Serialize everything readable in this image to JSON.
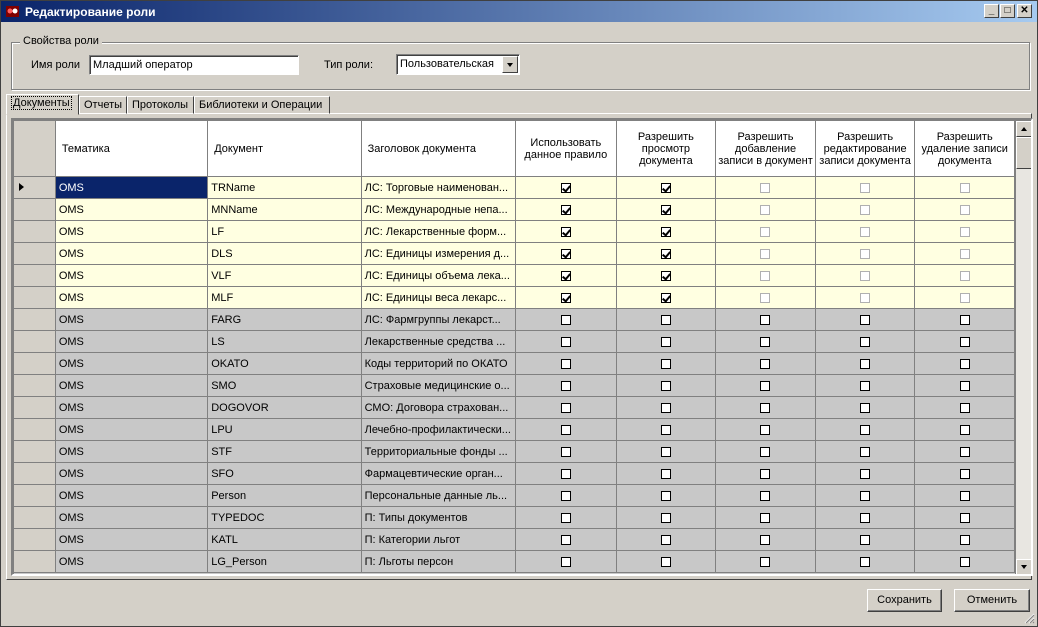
{
  "window": {
    "title": "Редактирование роли",
    "minimize": "_",
    "maximize": "□",
    "close": "✕"
  },
  "role_props": {
    "legend": "Свойства роли",
    "name_label": "Имя роли",
    "name_value": "Младший оператор",
    "type_label": "Тип роли:",
    "type_value": "Пользовательская"
  },
  "tabs": [
    {
      "label": "Документы"
    },
    {
      "label": "Отчеты"
    },
    {
      "label": "Протоколы"
    },
    {
      "label": "Библиотеки и Операции"
    }
  ],
  "grid": {
    "columns": [
      "Тематика",
      "Документ",
      "Заголовок документа",
      "Использовать данное правило",
      "Разрешить просмотр документа",
      "Разрешить добавление записи в документ",
      "Разрешить редактирование записи документа",
      "Разрешить удаление записи документа"
    ],
    "rows": [
      {
        "theme": "OMS",
        "doc": "TRName",
        "caption": "ЛС: Торговые наименован...",
        "use": true,
        "view": true,
        "add": false,
        "edit": false,
        "del": false,
        "enabled": true
      },
      {
        "theme": "OMS",
        "doc": "MNName",
        "caption": "ЛС: Международные непа...",
        "use": true,
        "view": true,
        "add": false,
        "edit": false,
        "del": false,
        "enabled": true
      },
      {
        "theme": "OMS",
        "doc": "LF",
        "caption": "ЛС: Лекарственные форм...",
        "use": true,
        "view": true,
        "add": false,
        "edit": false,
        "del": false,
        "enabled": true
      },
      {
        "theme": "OMS",
        "doc": "DLS",
        "caption": "ЛС: Единицы измерения д...",
        "use": true,
        "view": true,
        "add": false,
        "edit": false,
        "del": false,
        "enabled": true
      },
      {
        "theme": "OMS",
        "doc": "VLF",
        "caption": "ЛС: Единицы объема лека...",
        "use": true,
        "view": true,
        "add": false,
        "edit": false,
        "del": false,
        "enabled": true
      },
      {
        "theme": "OMS",
        "doc": "MLF",
        "caption": "ЛС: Единицы веса лекарс...",
        "use": true,
        "view": true,
        "add": false,
        "edit": false,
        "del": false,
        "enabled": true
      },
      {
        "theme": "OMS",
        "doc": "FARG",
        "caption": "ЛС: Фармгруппы лекарст...",
        "use": false,
        "view": false,
        "add": false,
        "edit": false,
        "del": false,
        "enabled": false
      },
      {
        "theme": "OMS",
        "doc": "LS",
        "caption": "Лекарственные средства ...",
        "use": false,
        "view": false,
        "add": false,
        "edit": false,
        "del": false,
        "enabled": false
      },
      {
        "theme": "OMS",
        "doc": "OKATO",
        "caption": "Коды территорий по ОКАТО",
        "use": false,
        "view": false,
        "add": false,
        "edit": false,
        "del": false,
        "enabled": false
      },
      {
        "theme": "OMS",
        "doc": "SMO",
        "caption": "Страховые медицинские о...",
        "use": false,
        "view": false,
        "add": false,
        "edit": false,
        "del": false,
        "enabled": false
      },
      {
        "theme": "OMS",
        "doc": "DOGOVOR",
        "caption": "СМО: Договора страхован...",
        "use": false,
        "view": false,
        "add": false,
        "edit": false,
        "del": false,
        "enabled": false
      },
      {
        "theme": "OMS",
        "doc": "LPU",
        "caption": "Лечебно-профилактически...",
        "use": false,
        "view": false,
        "add": false,
        "edit": false,
        "del": false,
        "enabled": false
      },
      {
        "theme": "OMS",
        "doc": "STF",
        "caption": "Территориальные фонды ...",
        "use": false,
        "view": false,
        "add": false,
        "edit": false,
        "del": false,
        "enabled": false
      },
      {
        "theme": "OMS",
        "doc": "SFO",
        "caption": "Фармацевтические орган...",
        "use": false,
        "view": false,
        "add": false,
        "edit": false,
        "del": false,
        "enabled": false
      },
      {
        "theme": "OMS",
        "doc": "Person",
        "caption": "Персональные данные ль...",
        "use": false,
        "view": false,
        "add": false,
        "edit": false,
        "del": false,
        "enabled": false
      },
      {
        "theme": "OMS",
        "doc": "TYPEDOC",
        "caption": "П: Типы документов",
        "use": false,
        "view": false,
        "add": false,
        "edit": false,
        "del": false,
        "enabled": false
      },
      {
        "theme": "OMS",
        "doc": "KATL",
        "caption": "П: Категории льгот",
        "use": false,
        "view": false,
        "add": false,
        "edit": false,
        "del": false,
        "enabled": false
      },
      {
        "theme": "OMS",
        "doc": "LG_Person",
        "caption": "П: Льготы персон",
        "use": false,
        "view": false,
        "add": false,
        "edit": false,
        "del": false,
        "enabled": false
      }
    ]
  },
  "buttons": {
    "save": "Сохранить",
    "cancel": "Отменить"
  },
  "colors": {
    "enabled_row": "#ffffe1",
    "disabled_row": "#c8c8c8",
    "selected": "#0a246a"
  }
}
